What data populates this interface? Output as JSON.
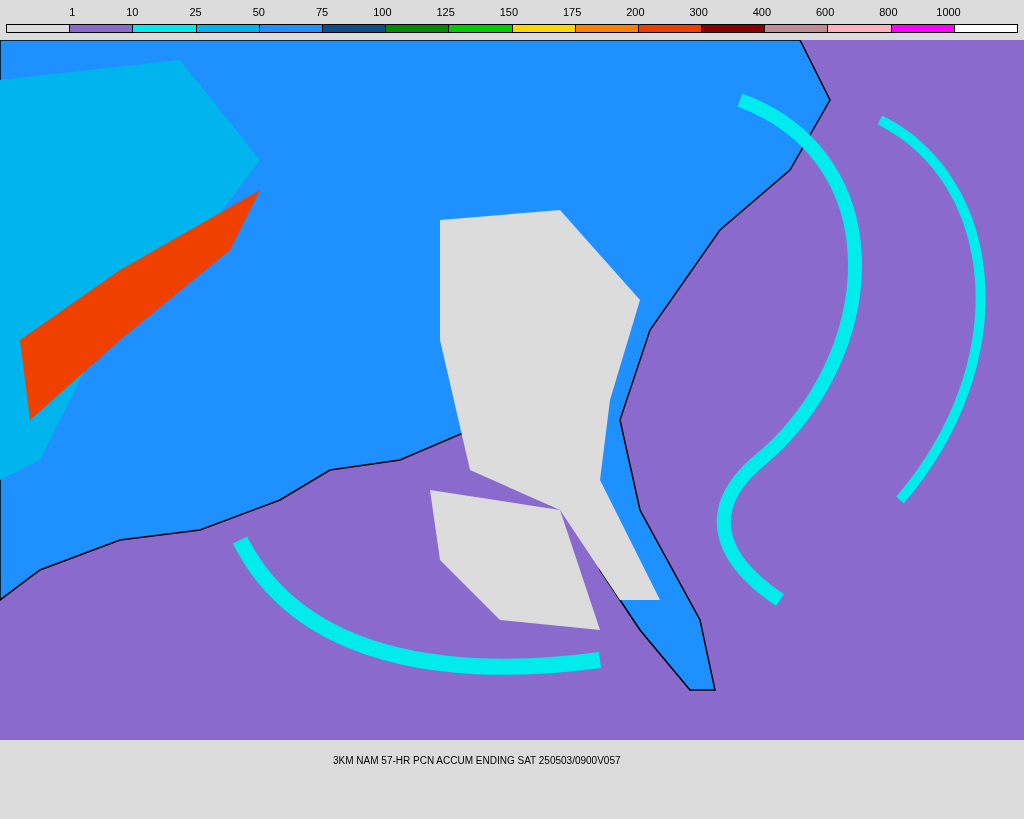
{
  "legend": {
    "segments": [
      {
        "color": "#dcdcdc",
        "label": "1"
      },
      {
        "color": "#8a6acd",
        "label": "10"
      },
      {
        "color": "#00ecec",
        "label": "25"
      },
      {
        "color": "#00b4ee",
        "label": "50"
      },
      {
        "color": "#1e90ff",
        "label": "75"
      },
      {
        "color": "#104e8b",
        "label": "100"
      },
      {
        "color": "#008b00",
        "label": "125"
      },
      {
        "color": "#00cd00",
        "label": "150"
      },
      {
        "color": "#ffd700",
        "label": "175"
      },
      {
        "color": "#ff8000",
        "label": "200"
      },
      {
        "color": "#f04000",
        "label": "300"
      },
      {
        "color": "#8b0000",
        "label": "400"
      },
      {
        "color": "#c08b96",
        "label": "600"
      },
      {
        "color": "#ffb0ba",
        "label": "800"
      },
      {
        "color": "#ff00ff",
        "label": "1000"
      },
      {
        "color": "#ffffff"
      }
    ]
  },
  "caption": "3KM NAM 57-HR PCN ACCUM ENDING SAT 250503/0900V057"
}
